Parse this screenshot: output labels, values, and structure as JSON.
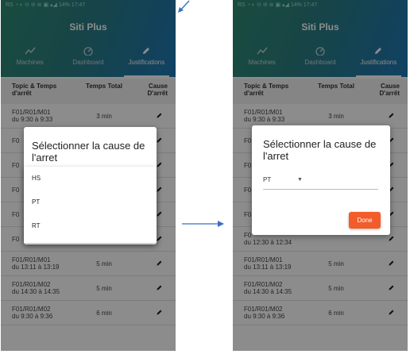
{
  "app_title": "Siti Plus",
  "status_bar": "RS  ◔ ◐  ⊙ ⊖ ⊜ ▣ ▴◢ 14% 17:47",
  "tabs": [
    {
      "label": "Machines",
      "icon": "trend-line-icon"
    },
    {
      "label": "Dashboard",
      "icon": "gauge-icon"
    },
    {
      "label": "Justifications",
      "icon": "pencil-icon"
    }
  ],
  "active_tab": "Justifications",
  "table": {
    "headers": [
      "Topic & Temps d'arrêt",
      "Temps Total",
      "Cause D'arrêt"
    ],
    "rows_left": [
      {
        "topic": "F01/R01/M01",
        "time": "du 9:30 à 9:33",
        "total": "3 min"
      },
      {
        "topic": "F0",
        "time": "",
        "total": ""
      },
      {
        "topic": "F0",
        "time": "",
        "total": ""
      },
      {
        "topic": "F0",
        "time": "",
        "total": ""
      },
      {
        "topic": "F0",
        "time": "",
        "total": ""
      },
      {
        "topic": "F0",
        "time": "",
        "total": ""
      },
      {
        "topic": "F01/R01/M01",
        "time": "du 13:11 à 13:19",
        "total": "5 min"
      },
      {
        "topic": "F01/R01/M02",
        "time": "du 14:30 à 14:35",
        "total": "5 min"
      },
      {
        "topic": "F01/R01/M02",
        "time": "du 9:30 à 9:36",
        "total": "6 min"
      }
    ],
    "rows_right": [
      {
        "topic": "F01/R01/M01",
        "time": "du 9:30 à 9:33",
        "total": "3 min"
      },
      {
        "topic": "F0",
        "time": "",
        "total": ""
      },
      {
        "topic": "F0",
        "time": "",
        "total": ""
      },
      {
        "topic": "F0",
        "time": "",
        "total": ""
      },
      {
        "topic": "F0",
        "time": "",
        "total": ""
      },
      {
        "topic": "F0",
        "time": "du 12:30 à 12:34",
        "total": ""
      },
      {
        "topic": "F01/R01/M01",
        "time": "du 13:11 à 13:19",
        "total": "5 min"
      },
      {
        "topic": "F01/R01/M02",
        "time": "du 14:30 à 14:35",
        "total": "5 min"
      },
      {
        "topic": "F01/R01/M02",
        "time": "du 9:30 à 9:36",
        "total": "6 min"
      }
    ]
  },
  "dialog": {
    "title": "Sélectionner la cause de l'arret",
    "options": [
      "HS",
      "PT",
      "RT"
    ],
    "selected": "PT",
    "done_label": "Done"
  },
  "colors": {
    "header_start": "#2f8a73",
    "header_end": "#1e77b5",
    "done_button": "#f25c2a",
    "arrow": "#3a6fc4"
  }
}
